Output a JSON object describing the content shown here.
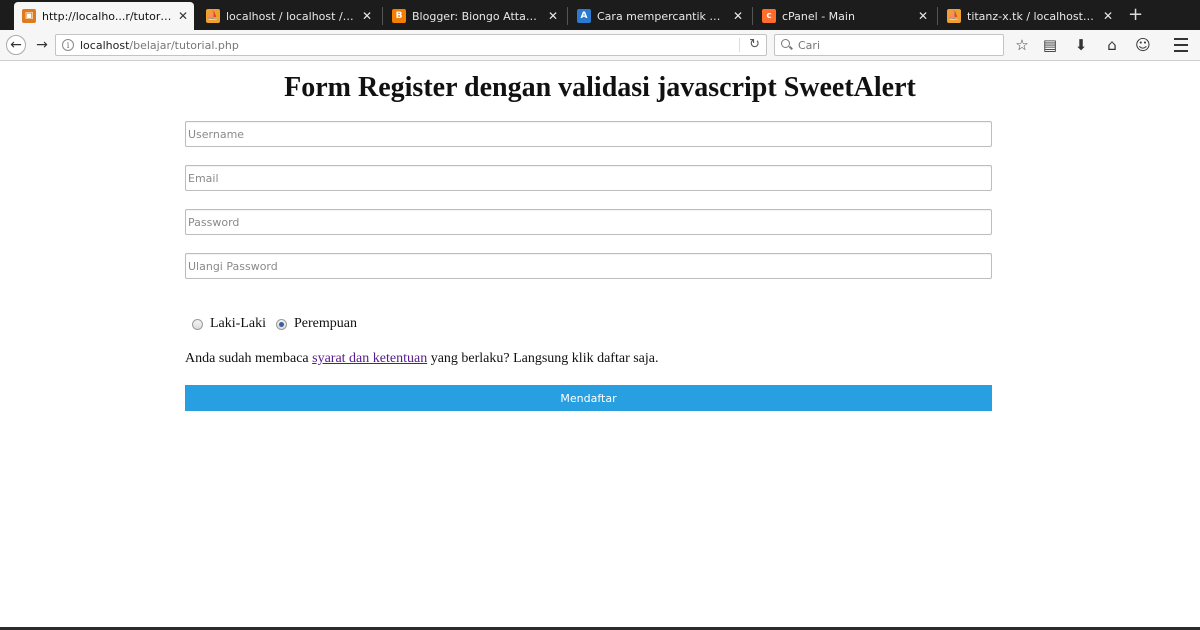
{
  "browser": {
    "tabs": [
      {
        "title": "http://localho...r/tutorial.php",
        "favicon": "page-icon",
        "active": true
      },
      {
        "title": "localhost / localhost / foru...",
        "favicon": "phpmyadmin-icon",
        "active": false
      },
      {
        "title": "Blogger: Biongo Attacker - ...",
        "favicon": "blogger-icon",
        "active": false
      },
      {
        "title": "Cara mempercantik alert jav...",
        "favicon": "site-icon",
        "active": false
      },
      {
        "title": "cPanel - Main",
        "favicon": "cpanel-icon",
        "active": false
      },
      {
        "title": "titanz-x.tk / localhost / titan...",
        "favicon": "phpmyadmin-icon",
        "active": false
      }
    ],
    "url": {
      "host": "localhost",
      "path": "/belajar/tutorial.php"
    },
    "search": {
      "placeholder": "Cari"
    }
  },
  "page": {
    "title": "Form Register dengan validasi javascript SweetAlert",
    "fields": {
      "username_placeholder": "Username",
      "email_placeholder": "Email",
      "password_placeholder": "Password",
      "confirm_placeholder": "Ulangi Password"
    },
    "gender": {
      "male_label": "Laki-Laki",
      "female_label": "Perempuan",
      "selected": "Perempuan"
    },
    "terms": {
      "before": "Anda sudah membaca ",
      "link": "syarat dan ketentuan",
      "after": " yang berlaku? Langsung klik daftar saja."
    },
    "submit_label": "Mendaftar"
  },
  "colors": {
    "button": "#279fe0",
    "link": "#551a8b",
    "tabstrip": "#1c1c1c"
  }
}
